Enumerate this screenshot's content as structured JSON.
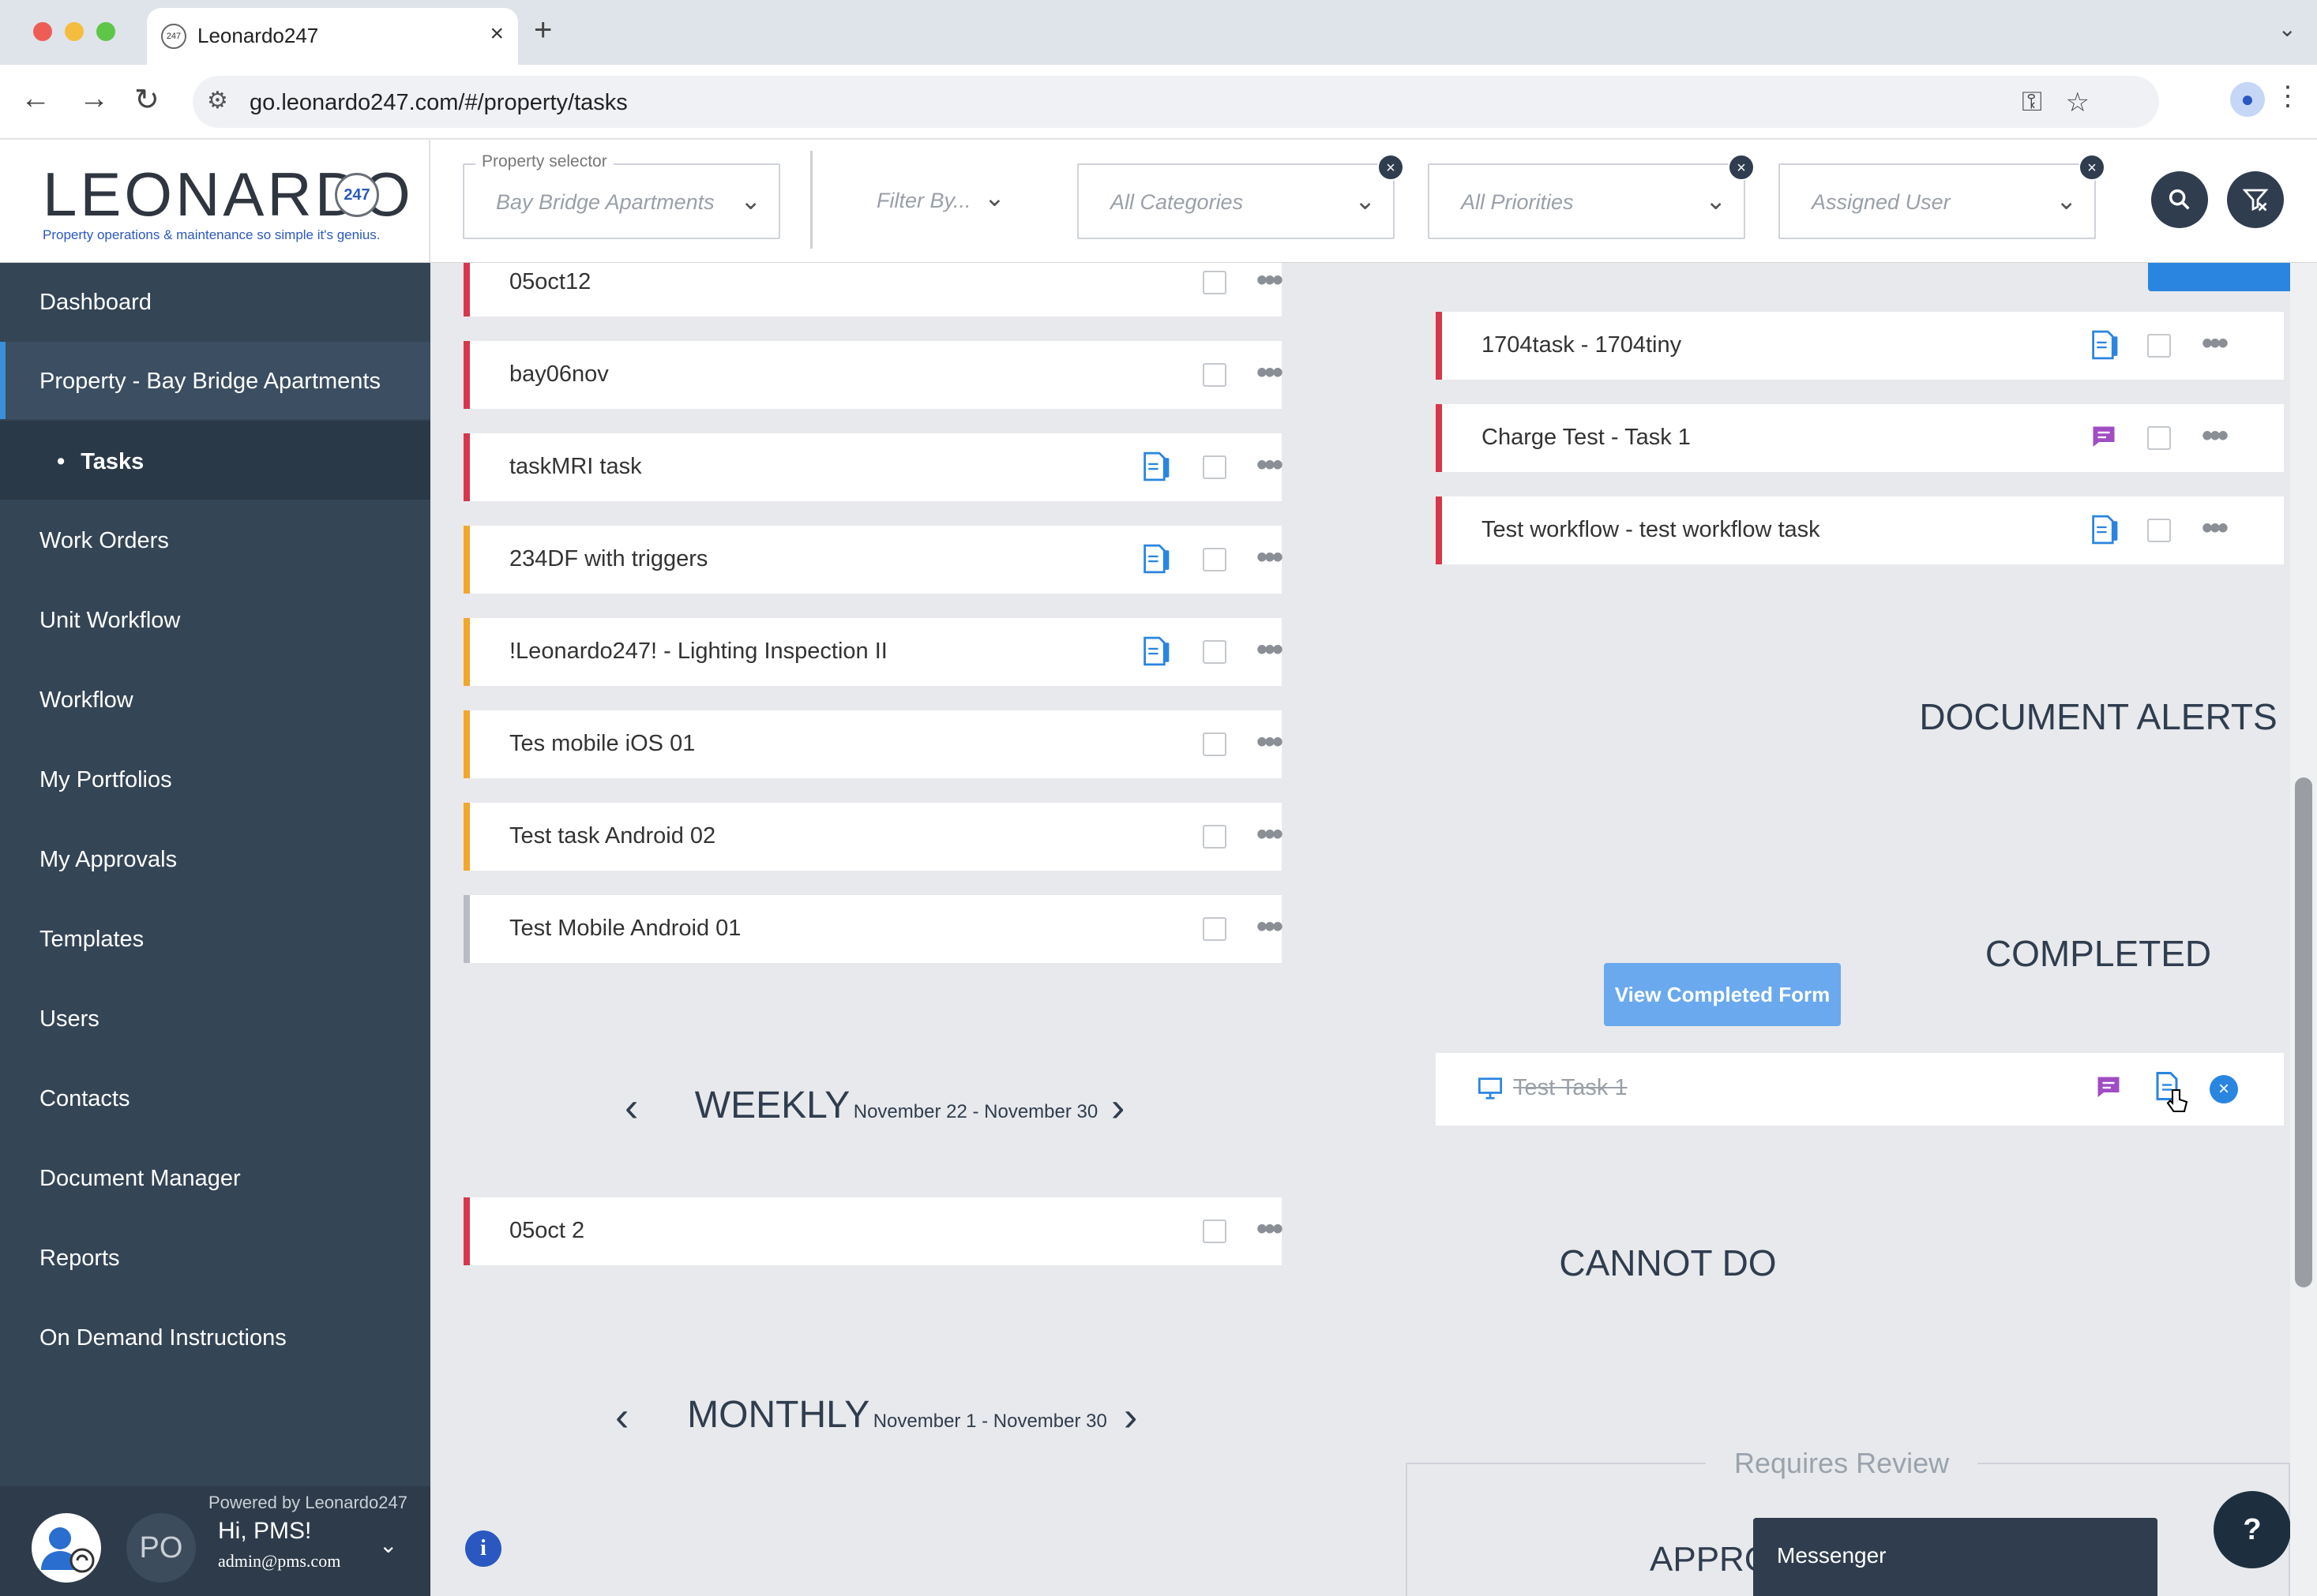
{
  "browser": {
    "tab_title": "Leonardo247",
    "favicon": "247",
    "url": "go.leonardo247.com/#/property/tasks"
  },
  "header": {
    "logo_word": "LEONARDO",
    "logo_badge": "247",
    "logo_tagline": "Property operations & maintenance so simple it's genius.",
    "property_selector_label": "Property selector",
    "property_selector_value": "Bay Bridge Apartments",
    "filter_by": "Filter By...",
    "categories": "All Categories",
    "priorities": "All Priorities",
    "assigned_user": "Assigned User"
  },
  "sidebar": {
    "items": [
      {
        "label": "Dashboard"
      },
      {
        "label": "Property - Bay Bridge Apartments"
      },
      {
        "label": "Tasks"
      },
      {
        "label": "Work Orders"
      },
      {
        "label": "Unit Workflow"
      },
      {
        "label": "Workflow"
      },
      {
        "label": "My Portfolios"
      },
      {
        "label": "My Approvals"
      },
      {
        "label": "Templates"
      },
      {
        "label": "Users"
      },
      {
        "label": "Contacts"
      },
      {
        "label": "Document Manager"
      },
      {
        "label": "Reports"
      },
      {
        "label": "On Demand Instructions"
      }
    ],
    "footer": {
      "powered_by": "Powered by Leonardo247",
      "initials": "PO",
      "greeting": "Hi, PMS!",
      "email": "admin@pms.com"
    }
  },
  "left_tasks": [
    {
      "label": "05oct12",
      "color": "#d6374a",
      "icon": ""
    },
    {
      "label": "bay06nov",
      "color": "#d6374a",
      "icon": ""
    },
    {
      "label": "taskMRI task",
      "color": "#d6374a",
      "icon": "document-icon"
    },
    {
      "label": "234DF with triggers",
      "color": "#f2a62c",
      "icon": "document-icon"
    },
    {
      "label": "!Leonardo247! - Lighting Inspection II",
      "color": "#f2a62c",
      "icon": "document-icon"
    },
    {
      "label": "Tes mobile iOS 01",
      "color": "#f2a62c",
      "icon": ""
    },
    {
      "label": "Test task Android 02",
      "color": "#f2a62c",
      "icon": ""
    },
    {
      "label": "Test Mobile Android 01",
      "color": "#b8bcc2",
      "icon": ""
    }
  ],
  "weekly": {
    "title": "WEEKLY",
    "range": "November 22 - November 30",
    "tasks": [
      {
        "label": "05oct 2",
        "color": "#d6374a"
      }
    ]
  },
  "monthly": {
    "title": "MONTHLY",
    "range": "November 1 - November 30"
  },
  "right_tasks": [
    {
      "label": "1704task - 1704tiny",
      "color": "#d6374a",
      "icon": "document-icon"
    },
    {
      "label": "Charge Test - Task 1",
      "color": "#d6374a",
      "icon": "chat-icon"
    },
    {
      "label": "Test workflow - test workflow task",
      "color": "#d6374a",
      "icon": "document-icon"
    }
  ],
  "sections": {
    "document_alerts": "DOCUMENT ALERTS",
    "completed": "COMPLETED",
    "view_completed_form": "View Completed Form",
    "completed_task": "Test Task 1",
    "cannot_do": "CANNOT DO",
    "requires_review": "Requires Review",
    "approvals_partial": "APPRO"
  },
  "widgets": {
    "messenger": "Messenger",
    "help": "?",
    "info": "i"
  }
}
